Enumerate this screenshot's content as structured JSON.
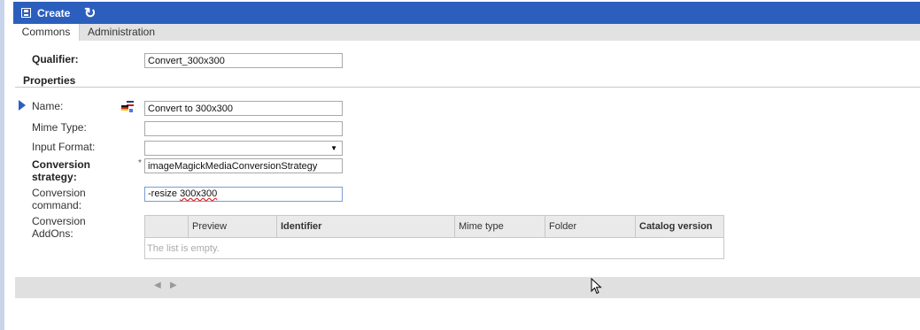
{
  "toolbar": {
    "create_label": "Create",
    "save_icon": "save-icon",
    "refresh_icon": "refresh-icon"
  },
  "tabs": [
    {
      "label": "Commons",
      "active": true
    },
    {
      "label": "Administration",
      "active": false
    }
  ],
  "qualifier": {
    "label": "Qualifier:",
    "value": "Convert_300x300"
  },
  "properties": {
    "title": "Properties",
    "name": {
      "label": "Name:",
      "value": "Convert to 300x300"
    },
    "mime_type": {
      "label": "Mime Type:",
      "value": ""
    },
    "input_format": {
      "label": "Input Format:",
      "value": ""
    },
    "conversion_strategy": {
      "label_line1": "Conversion",
      "label_line2": "strategy:",
      "required_mark": "*",
      "value": "imageMagickMediaConversionStrategy"
    },
    "conversion_command": {
      "label_line1": "Conversion",
      "label_line2": "command:",
      "value_prefix": "-resize ",
      "value_rest": "300x300"
    },
    "conversion_addons": {
      "label_line1": "Conversion",
      "label_line2": "AddOns:",
      "columns": [
        "",
        "Preview",
        "Identifier",
        "Mime type",
        "Folder",
        "Catalog version"
      ],
      "empty_text": "The list is empty."
    }
  },
  "pager": {
    "prev": "◀",
    "next": "▶"
  },
  "colors": {
    "toolbar_bg": "#2c5fbd",
    "accent": "#2c5fbd"
  }
}
